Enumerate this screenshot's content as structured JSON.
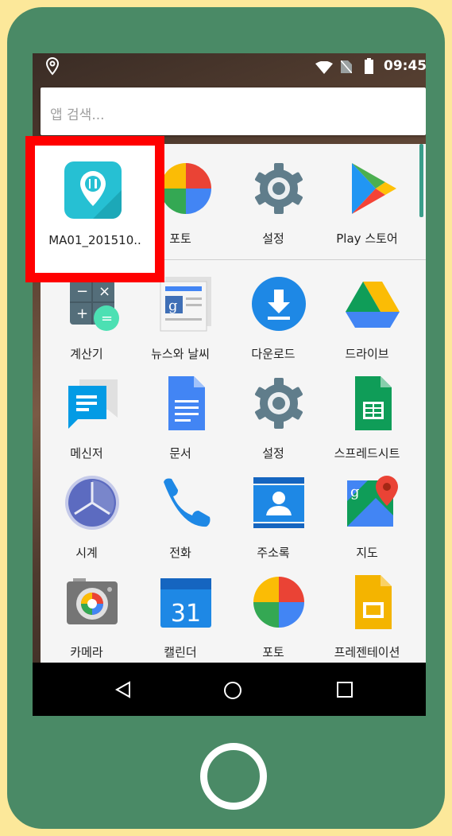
{
  "status_bar": {
    "time": "09:45",
    "icons": [
      "location-icon",
      "wifi-icon",
      "no-sim-icon",
      "battery-icon"
    ]
  },
  "search": {
    "placeholder": "앱 검색..."
  },
  "apps": {
    "highlighted": {
      "label": "MA01_201510..",
      "icon": "restaurant-location-icon",
      "highlight_color": "#ff0000"
    },
    "row1": [
      {
        "label": "포토",
        "icon": "photos-icon"
      },
      {
        "label": "설정",
        "icon": "settings-gear-icon"
      },
      {
        "label": "Play 스토어",
        "icon": "play-store-icon"
      }
    ],
    "row2": [
      {
        "label": "계산기",
        "icon": "calculator-icon"
      },
      {
        "label": "뉴스와 날씨",
        "icon": "news-weather-icon"
      },
      {
        "label": "다운로드",
        "icon": "download-icon"
      },
      {
        "label": "드라이브",
        "icon": "drive-icon"
      }
    ],
    "row3": [
      {
        "label": "메신저",
        "icon": "messenger-icon"
      },
      {
        "label": "문서",
        "icon": "docs-icon"
      },
      {
        "label": "설정",
        "icon": "settings-gear-icon"
      },
      {
        "label": "스프레드시트",
        "icon": "sheets-icon"
      }
    ],
    "row4": [
      {
        "label": "시계",
        "icon": "clock-icon"
      },
      {
        "label": "전화",
        "icon": "phone-icon"
      },
      {
        "label": "주소록",
        "icon": "contacts-icon"
      },
      {
        "label": "지도",
        "icon": "maps-icon"
      }
    ],
    "row5": [
      {
        "label": "카메라",
        "icon": "camera-icon"
      },
      {
        "label": "캘린더",
        "icon": "calendar-icon",
        "badge": "31"
      },
      {
        "label": "포토",
        "icon": "photos-icon"
      },
      {
        "label": "프레젠테이션",
        "icon": "slides-icon"
      }
    ]
  },
  "nav_bar": {
    "buttons": [
      "back-icon",
      "home-icon",
      "recents-icon"
    ]
  },
  "colors": {
    "frame": "#fce89a",
    "phone": "#4a8a66",
    "drawer": "#f5f5f5",
    "accent": "#3a9e8a"
  }
}
